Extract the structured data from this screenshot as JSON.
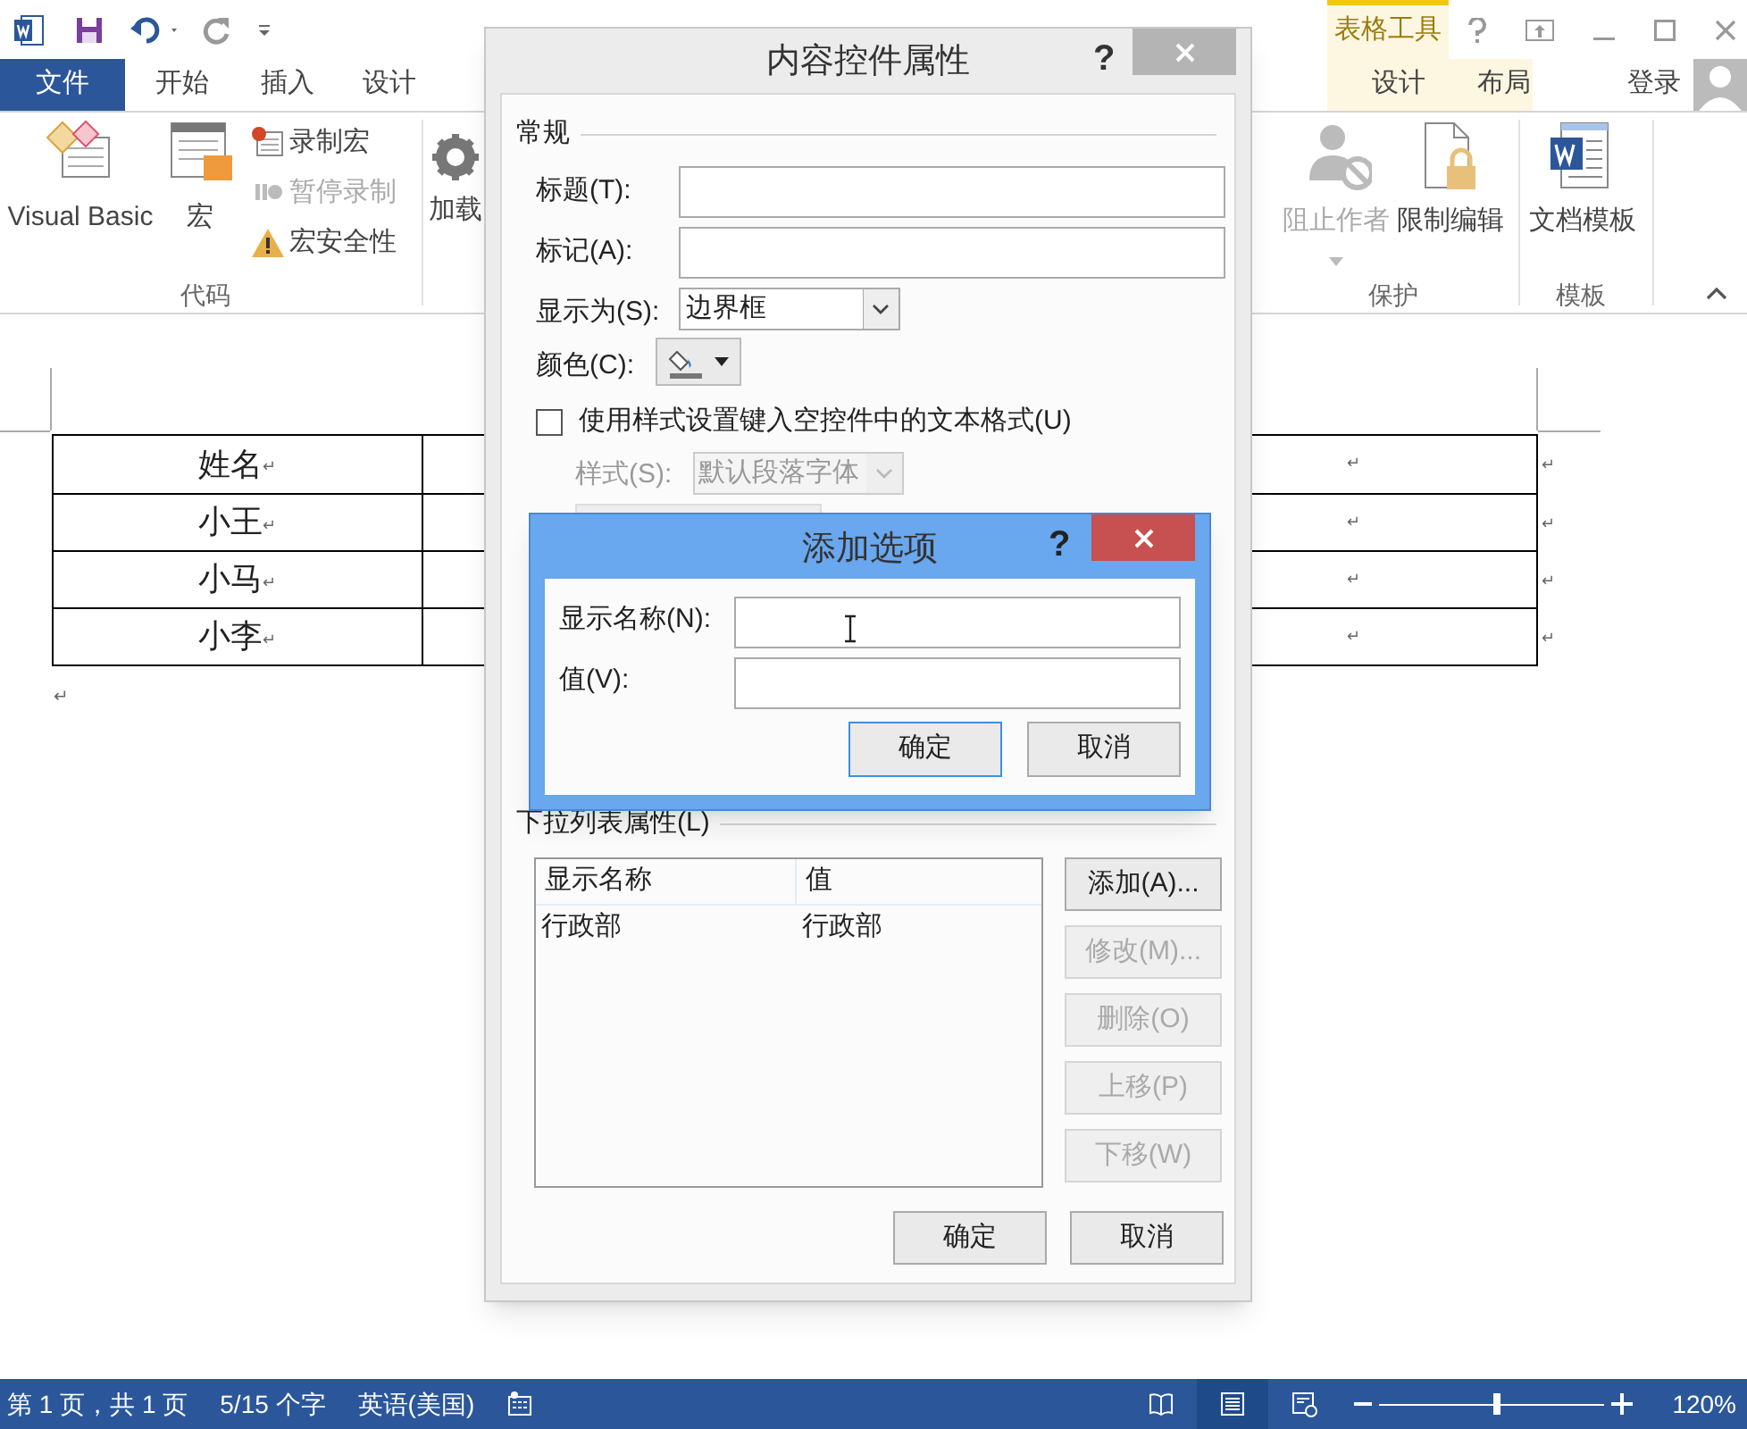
{
  "title_bar": {
    "context_group": "表格工具"
  },
  "ribbon_tabs": [
    {
      "label": "文件",
      "kind": "file"
    },
    {
      "label": "开始",
      "kind": "normal"
    },
    {
      "label": "插入",
      "kind": "normal"
    },
    {
      "label": "设计",
      "kind": "normal"
    },
    {
      "label": "设计",
      "kind": "context"
    },
    {
      "label": "布局",
      "kind": "context"
    }
  ],
  "account": {
    "label": "登录"
  },
  "ribbon": {
    "code_group": {
      "label": "代码",
      "large": [
        {
          "label": "Visual Basic",
          "kind": "vb"
        },
        {
          "label": "宏",
          "kind": "macro"
        }
      ],
      "small": [
        {
          "label": "录制宏",
          "kind": "record",
          "disabled": false
        },
        {
          "label": "暂停录制",
          "kind": "pause",
          "disabled": true
        },
        {
          "label": "宏安全性",
          "kind": "warning",
          "disabled": false
        }
      ]
    },
    "addins": {
      "label": "加载"
    },
    "protect_group": {
      "label": "保护",
      "buttons": [
        {
          "label": "阻止作者",
          "kind": "block",
          "disabled": true
        },
        {
          "label": "限制编辑",
          "kind": "lock",
          "disabled": false
        }
      ]
    },
    "template_group": {
      "label": "模板",
      "buttons": [
        {
          "label": "文档模板",
          "kind": "template",
          "disabled": false
        }
      ]
    }
  },
  "document": {
    "rows": [
      {
        "first": "姓名",
        "mark": "↵",
        "last": "↵",
        "end": "↵"
      },
      {
        "first": "小王",
        "mark": "↵",
        "last": "↵",
        "end": "↵"
      },
      {
        "first": "小马",
        "mark": "↵",
        "last": "↵",
        "end": "↵"
      },
      {
        "first": "小李",
        "mark": "↵",
        "last": "↵",
        "end": "↵"
      }
    ],
    "paragraph_mark": "↵"
  },
  "properties_dialog": {
    "title": "内容控件属性",
    "help": "?",
    "general_section": "常规",
    "fields": [
      {
        "label": "标题(T):",
        "kind": "text"
      },
      {
        "label": "标记(A):",
        "kind": "text"
      },
      {
        "label": "显示为(S):",
        "kind": "select",
        "value": "边界框"
      },
      {
        "label": "颜色(C):",
        "kind": "color"
      }
    ],
    "style_checkbox": {
      "label": "使用样式设置键入空控件中的文本格式(U)",
      "checked": false
    },
    "style_field": {
      "label": "样式(S):",
      "value": "默认段落字体",
      "disabled": true
    },
    "dropdown_section": "下拉列表属性(L)",
    "list": {
      "columns": [
        "显示名称",
        "值"
      ],
      "rows": [
        [
          "行政部",
          "行政部"
        ]
      ]
    },
    "side_buttons": [
      {
        "label": "添加(A)...",
        "disabled": false
      },
      {
        "label": "修改(M)...",
        "disabled": true
      },
      {
        "label": "删除(O)",
        "disabled": true
      },
      {
        "label": "上移(P)",
        "disabled": true
      },
      {
        "label": "下移(W)",
        "disabled": true
      }
    ],
    "buttons": [
      "确定",
      "取消"
    ]
  },
  "add_dialog": {
    "title": "添加选项",
    "help": "?",
    "fields": [
      {
        "label": "显示名称(N):"
      },
      {
        "label": "值(V):"
      }
    ],
    "buttons": [
      {
        "label": "确定",
        "default": true
      },
      {
        "label": "取消",
        "default": false
      }
    ]
  },
  "status_bar": {
    "items": [
      "第 1 页，共 1 页",
      "5/15 个字",
      "英语(美国)"
    ],
    "views": [
      {
        "kind": "read",
        "selected": false
      },
      {
        "kind": "print",
        "selected": true
      },
      {
        "kind": "web",
        "selected": false
      }
    ],
    "zoom": {
      "level": 0.52,
      "label": "120%"
    }
  }
}
